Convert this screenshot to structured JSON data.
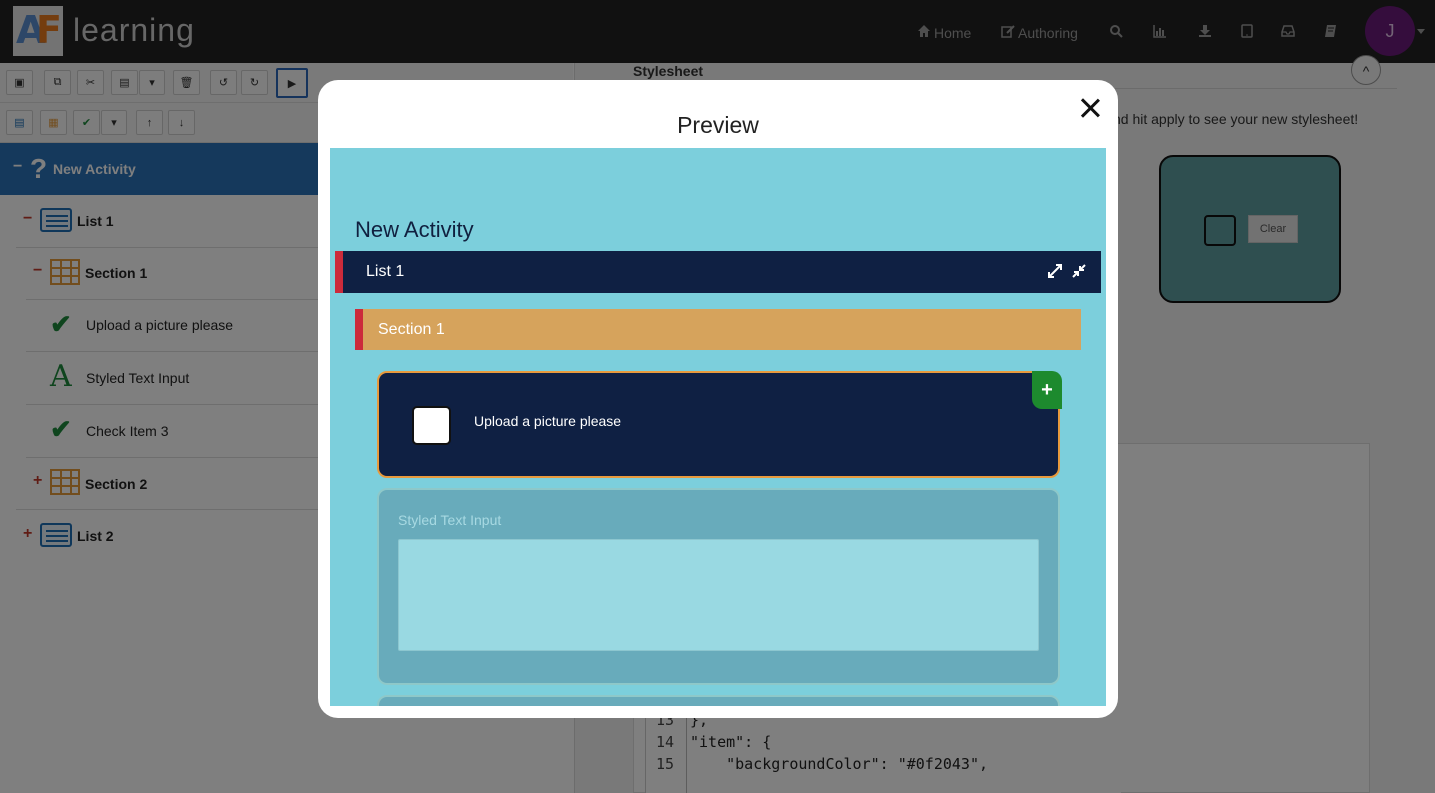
{
  "header": {
    "logo_letters": "AF",
    "logo_text": "learning",
    "nav": {
      "home": "Home",
      "authoring": "Authoring"
    },
    "avatar_initial": "J"
  },
  "tree": {
    "root": "New Activity",
    "items": [
      {
        "label": "List 1",
        "sign": "−"
      },
      {
        "label": "Section 1",
        "sign": "−"
      },
      {
        "label": "Upload a picture please"
      },
      {
        "label": "Styled Text Input"
      },
      {
        "label": "Check Item 3"
      },
      {
        "label": "Section 2",
        "sign": "+"
      },
      {
        "label": "List 2",
        "sign": "+"
      }
    ]
  },
  "stylesheet": {
    "heading": "Stylesheet",
    "hint": "nd hit apply to see your new stylesheet!",
    "preview_button": "Clear",
    "code": [
      {
        "num": "13",
        "text": "},"
      },
      {
        "num": "14",
        "text": "\"item\": {"
      },
      {
        "num": "15",
        "text": "    \"backgroundColor\": \"#0f2043\","
      }
    ]
  },
  "modal": {
    "title": "Preview",
    "activity_title": "New Activity",
    "list_label": "List 1",
    "section_label": "Section 1",
    "item_label": "Upload a picture please",
    "add_symbol": "+",
    "text_input_label": "Styled Text Input",
    "text_input_value": ""
  },
  "colors": {
    "item_background": "#0f2043",
    "section_background": "#d6a35c",
    "canvas_background": "#7ccfdc",
    "accent_red": "#cc2b3b",
    "add_green": "#1d8a2e"
  }
}
